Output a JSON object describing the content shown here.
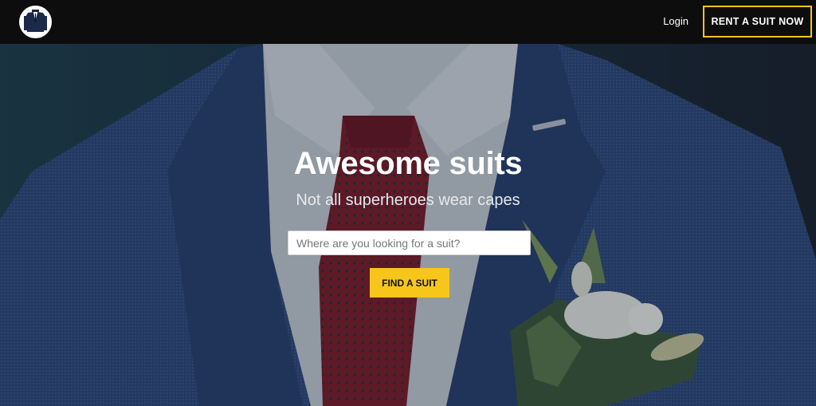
{
  "header": {
    "logo_icon": "suit-jacket-icon",
    "login_label": "Login",
    "cta_label": "RENT A SUIT NOW",
    "accent_color": "#f4c419"
  },
  "hero": {
    "title": "Awesome suits",
    "subtitle": "Not all superheroes wear capes",
    "search": {
      "placeholder": "Where are you looking for a suit?",
      "value": ""
    },
    "button_label": "FIND A SUIT",
    "button_color": "#f7c61b"
  }
}
